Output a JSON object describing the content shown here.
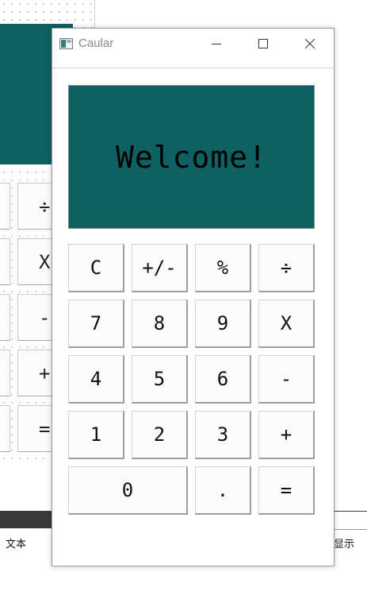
{
  "window": {
    "title": "Caular",
    "controls": {
      "minimize_icon": "minimize-icon",
      "maximize_icon": "maximize-icon",
      "close_icon": "close-icon"
    }
  },
  "display": {
    "text": "Welcome!",
    "background": "#0f6061"
  },
  "keypad": {
    "rows": [
      [
        "C",
        "+/-",
        "%",
        "÷"
      ],
      [
        "7",
        "8",
        "9",
        "X"
      ],
      [
        "4",
        "5",
        "6",
        "-"
      ],
      [
        "1",
        "2",
        "3",
        "+"
      ],
      [
        "0",
        ".",
        "="
      ]
    ]
  },
  "background_window": {
    "visible_keys": [
      "÷",
      "X",
      "-",
      "+",
      "="
    ],
    "status_left": "文本",
    "status_right": "显示"
  }
}
